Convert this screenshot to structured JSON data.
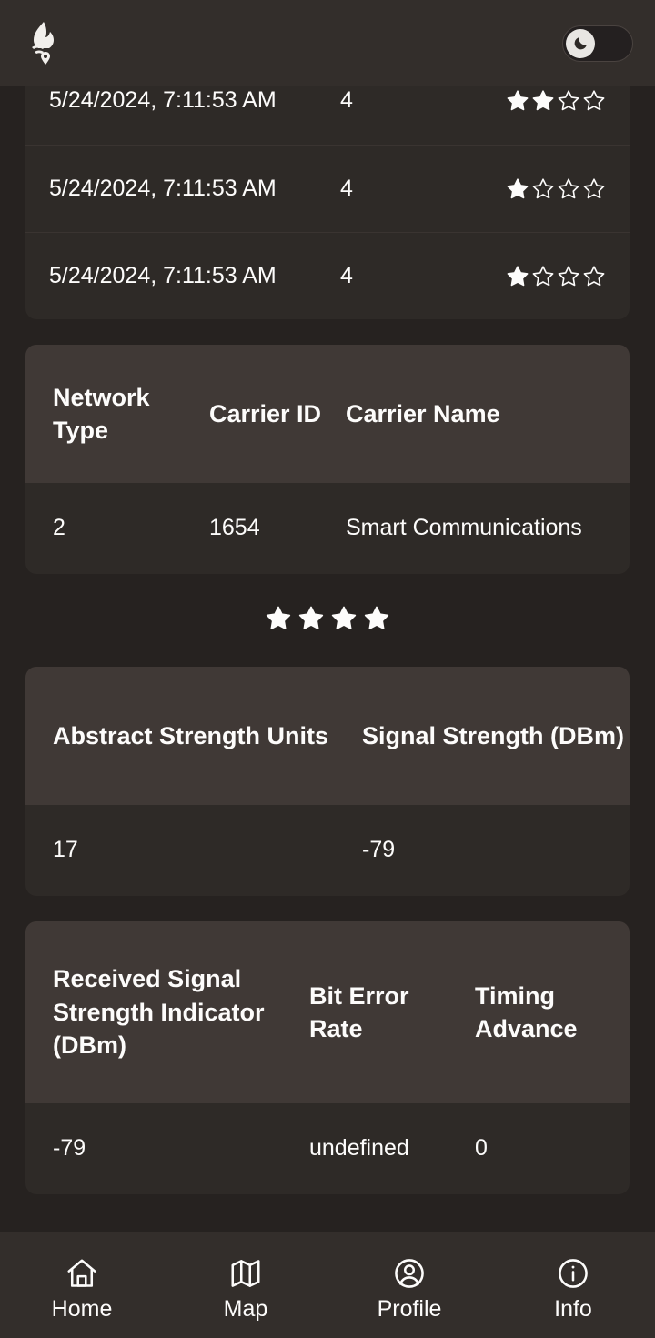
{
  "app": {
    "logo_icon": "flame-wifi-location-icon",
    "background_color": "#262220",
    "surface_color": "#2e2a27",
    "header_row_color": "#403936",
    "text_color": "#fdfcfb"
  },
  "appbar": {
    "theme_toggle": {
      "label": "dark-mode-toggle",
      "icon": "moon-icon",
      "state": "on"
    }
  },
  "history_table": {
    "rows": [
      {
        "timestamp": "5/24/2024, 7:11:53 AM",
        "value": "4",
        "stars_filled": 2,
        "stars_total": 4
      },
      {
        "timestamp": "5/24/2024, 7:11:53 AM",
        "value": "4",
        "stars_filled": 1,
        "stars_total": 4
      },
      {
        "timestamp": "5/24/2024, 7:11:53 AM",
        "value": "4",
        "stars_filled": 1,
        "stars_total": 4
      }
    ]
  },
  "carrier_table": {
    "headers": [
      "Network Type",
      "Carrier ID",
      "Carrier Name"
    ],
    "rows": [
      {
        "network_type": "2",
        "carrier_id": "1654",
        "carrier_name": "Smart Communications"
      }
    ]
  },
  "signal_rating": {
    "stars_filled": 4,
    "stars_total": 4
  },
  "strength_table": {
    "headers": [
      "Abstract Strength Units",
      "Signal Strength (DBm)"
    ],
    "rows": [
      {
        "abstract_units": "17",
        "signal_dbm": "-79"
      }
    ]
  },
  "rssi_table": {
    "headers": [
      "Received Signal Strength Indicator (DBm)",
      "Bit Error Rate",
      "Timing Advance"
    ],
    "rows": [
      {
        "rssi": "-79",
        "bit_error_rate": "undefined",
        "timing_advance": "0"
      }
    ]
  },
  "bottom_nav": {
    "items": [
      {
        "label": "Home",
        "icon": "home-icon"
      },
      {
        "label": "Map",
        "icon": "map-icon"
      },
      {
        "label": "Profile",
        "icon": "user-circle-icon"
      },
      {
        "label": "Info",
        "icon": "info-circle-icon"
      }
    ]
  }
}
